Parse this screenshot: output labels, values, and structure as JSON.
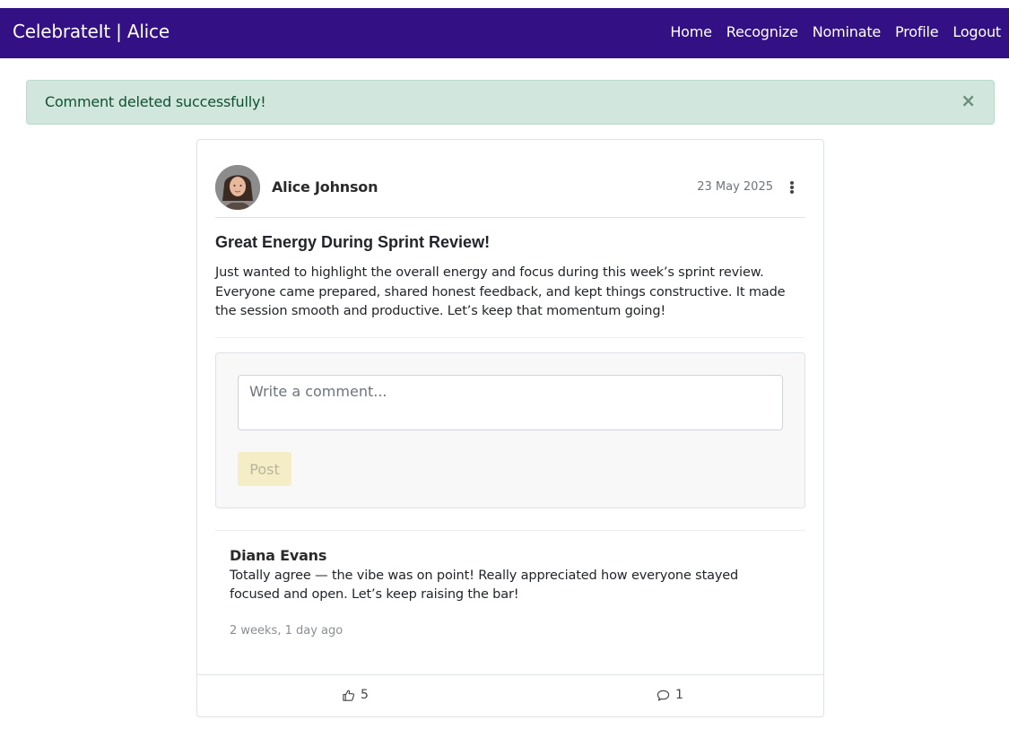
{
  "navbar": {
    "brand": "CelebrateIt | Alice",
    "links": [
      "Home",
      "Recognize",
      "Nominate",
      "Profile",
      "Logout"
    ],
    "color": "#341085"
  },
  "alert": {
    "message": "Comment deleted successfully!",
    "close_icon": "×"
  },
  "post": {
    "author": "Alice Johnson",
    "date": "23 May 2025",
    "title": "Great Energy During Sprint Review!",
    "body": "Just wanted to highlight the overall energy and focus during this week’s sprint review. Everyone came prepared, shared honest feedback, and kept things constructive. It made the session smooth and productive. Let’s keep that momentum going!",
    "comment_placeholder": "Write a comment...",
    "post_button": "Post",
    "likes": "5",
    "comment_count": "1"
  },
  "comments": [
    {
      "author": "Diana Evans",
      "text": "Totally agree — the vibe was on point! Really appreciated how everyone stayed focused and open. Let’s keep raising the bar!",
      "time": "2 weeks, 1 day ago"
    }
  ]
}
